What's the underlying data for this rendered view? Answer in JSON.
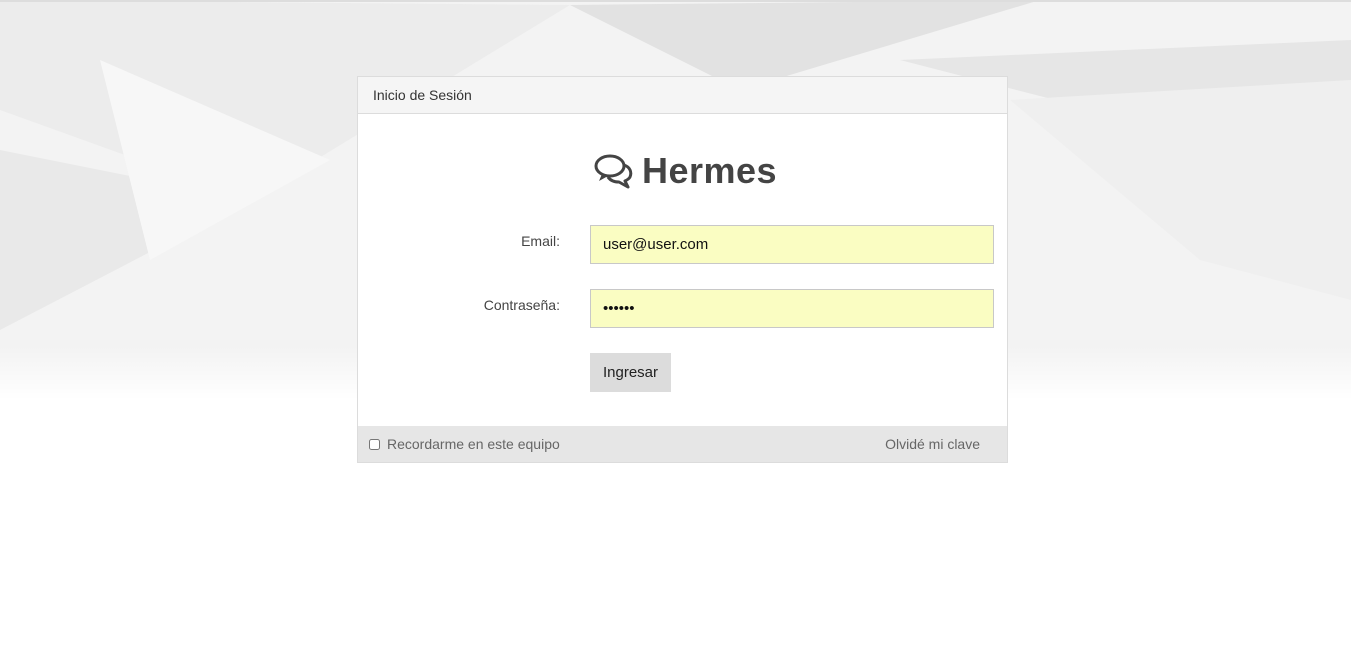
{
  "panel": {
    "title": "Inicio de Sesión"
  },
  "brand": {
    "name": "Hermes",
    "icon": "chat-bubbles-icon"
  },
  "form": {
    "email_label": "Email:",
    "email_value": "user@user.com",
    "password_label": "Contraseña:",
    "password_value": "••••••",
    "submit_label": "Ingresar"
  },
  "footer": {
    "remember_label": "Recordarme en este equipo",
    "remember_checked": false,
    "forgot_label": "Olvidé mi clave"
  },
  "colors": {
    "input_autofill": "#fafdc2",
    "button_bg": "#dcdcdc",
    "footer_bg": "#e6e6e6",
    "header_bg": "#f5f5f5"
  }
}
